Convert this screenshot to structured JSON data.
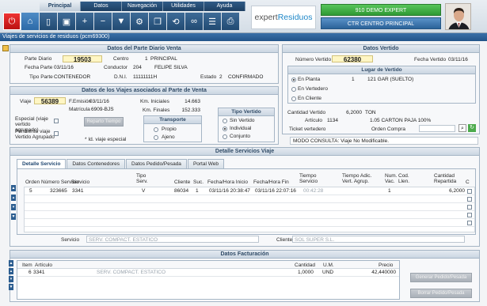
{
  "menu": [
    "Principal",
    "Datos",
    "Navegación",
    "Utilidades",
    "Ayuda"
  ],
  "menu_active_index": 0,
  "toolbar_icons": [
    "power-icon",
    "home-icon",
    "new-document-icon",
    "save-icon",
    "add-icon",
    "remove-icon",
    "filter-icon",
    "settings-icon",
    "copy-icon",
    "sync-icon",
    "binoculars-icon",
    "list-icon",
    "print-icon"
  ],
  "brand": {
    "logo_part1": "expert",
    "logo_part2": "Residuos",
    "company": "910 DEMO EXPERT",
    "center": "CTR CENTRO PRINCIPAL"
  },
  "window_title": "Viajes de servicios de residuos (pcm69300)",
  "parte_diario": {
    "title": "Datos del Parte Diario Venta",
    "parte_diario_label": "Parte Diario",
    "parte_diario_value": "19503",
    "centro_label": "Centro",
    "centro_code": "1",
    "centro_name": "PRINCIPAL",
    "fecha_parte_label": "Fecha Parte",
    "fecha_parte_value": "03/11/16",
    "conductor_label": "Conductor",
    "conductor_code": "204",
    "conductor_name": "FELIPE SILVA",
    "tipo_parte_label": "Tipo Parte",
    "tipo_parte_value": "CONTENEDOR",
    "dni_label": "D.N.I.",
    "dni_value": "11111111H",
    "estado_label": "Estado",
    "estado_code": "2",
    "estado_name": "CONFIRMADO"
  },
  "viajes": {
    "title": "Datos de los Viajes asociados al Parte de Venta",
    "viaje_label": "Viaje",
    "viaje_value": "56389",
    "f_emision_label": "F.Emisión",
    "f_emision_value": "03/11/16",
    "matricula_label": "Matrícula",
    "matricula_value": "6909-BJS",
    "km_iniciales_label": "Km. Iniciales",
    "km_iniciales_value": "14.663",
    "km_finales_label": "Km. Finales",
    "km_finales_value": "152.333",
    "especial_label": "Especial (viaje vertido agrupado)",
    "pendiente_label": "Pendiente viaje Vertido Agrupado",
    "reparto_tiempo_label": "Reparto Tiempo",
    "id_viaje_especial_label": "* Id. viaje especial",
    "transporte_title": "Transporte",
    "transporte_options": [
      "Propio",
      "Ajeno"
    ],
    "tipo_vertido_title": "Tipo Vertido",
    "tipo_vertido_options": [
      "Sin Vertido",
      "Individual",
      "Conjunto"
    ],
    "tipo_vertido_selected": 1
  },
  "vertido": {
    "title": "Datos Vertido",
    "numero_vertido_label": "Número Vertido",
    "numero_vertido_value": "62380",
    "fecha_vertido_label": "Fecha Vertido",
    "fecha_vertido_value": "03/11/16",
    "lugar_title": "Lugar de Vertido",
    "lugar_options": [
      "En Planta",
      "En Vertedero",
      "En Cliente"
    ],
    "lugar_selected": 0,
    "planta_code": "1",
    "planta_name": "121 GAR (SUELTO)",
    "cantidad_vertido_label": "Cantidad Vertido",
    "cantidad_vertido_value": "6,2000",
    "cantidad_vertido_unit": "TON",
    "articulo_label": "Artículo",
    "articulo_code": "1134",
    "articulo_name": "1.05 CARTON PAJA 100%",
    "ticket_label": "Ticket vertedero",
    "orden_compra_label": "Orden Compra"
  },
  "modo": "MODO CONSULTA:  Viaje No Modificable.",
  "servicios": {
    "title": "Detalle Servicios Viaje",
    "tabs": [
      "Detalle Servicio",
      "Datos Contenedores",
      "Datos Pedido/Pesada",
      "Portal Web"
    ],
    "tab_active_index": 0,
    "columns": [
      "Orden",
      "Número Servicio",
      "Servicio",
      "Tipo Serv.",
      "Cliente",
      "Suc.",
      "Fecha/Hora Inicio",
      "Fecha/Hora Fin",
      "Tiempo Servicio",
      "Tiempo Adic. Vert. Agrup.",
      "Num. Vac.",
      "Cod. Llen.",
      "Cantidad Repartida",
      "C"
    ],
    "rows": [
      {
        "orden": "5",
        "numero": "323665",
        "servicio": "3341",
        "tipo": "V",
        "cliente": "86034",
        "suc": "1",
        "inicio": "03/11/16 20:38:47",
        "fin": "03/11/16 22:07:16",
        "tiempo": "00:42:28",
        "adic": "",
        "vac": "1",
        "llen": "",
        "cantidad": "6,2000",
        "c": "check"
      }
    ],
    "servicio_label": "Servicio",
    "servicio_value": "SERV. COMPACT. ESTATICO",
    "cliente_label": "Cliente",
    "cliente_value": "SOL SUPER S.L."
  },
  "facturacion": {
    "title": "Datos Facturación",
    "columns": [
      "Item",
      "Artículo",
      "Cantidad",
      "U.M.",
      "Precio"
    ],
    "rows": [
      {
        "item": "6",
        "articulo": "3341",
        "desc": "SERV. COMPACT. ESTATICO",
        "cantidad": "1,0000",
        "um": "UND",
        "precio": "42,440000"
      }
    ],
    "generar_label": "Generar Pedido/Pesada",
    "borrar_label": "Borrar Pedido/Pesada"
  }
}
